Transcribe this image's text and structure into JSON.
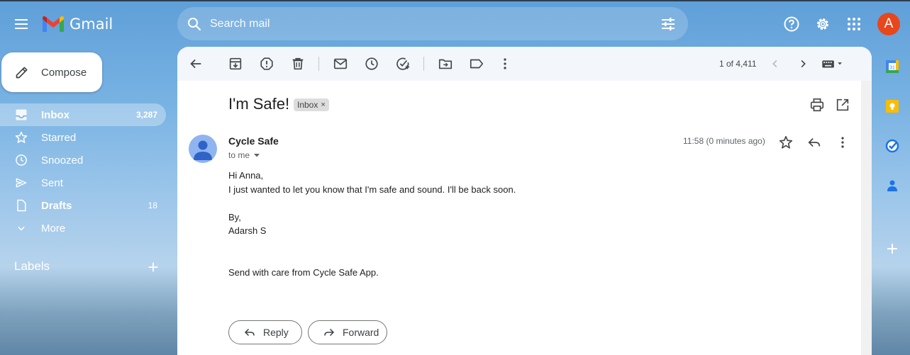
{
  "app": {
    "name": "Gmail"
  },
  "header": {
    "search_placeholder": "Search mail",
    "avatar_initial": "A"
  },
  "nav": {
    "compose_label": "Compose",
    "items": [
      {
        "label": "Inbox",
        "count": "3,287",
        "icon": "inbox-icon",
        "active": true
      },
      {
        "label": "Starred",
        "count": "",
        "icon": "star-icon"
      },
      {
        "label": "Snoozed",
        "count": "",
        "icon": "clock-icon"
      },
      {
        "label": "Sent",
        "count": "",
        "icon": "send-icon"
      },
      {
        "label": "Drafts",
        "count": "18",
        "icon": "draft-icon"
      },
      {
        "label": "More",
        "count": "",
        "icon": "chevron-down-icon"
      }
    ],
    "labels_title": "Labels"
  },
  "toolbar": {
    "page_count": "1 of 4,411"
  },
  "email": {
    "subject": "I'm Safe!",
    "label_chip": "Inbox",
    "label_chip_close": "×",
    "sender_name": "Cycle Safe",
    "recipient": "to me",
    "time": "11:58 (0 minutes ago)",
    "body": [
      "Hi Anna,",
      "I just wanted to let you know that I'm safe and sound. I'll be back soon.",
      "By,",
      "Adarsh S",
      "Send with care from Cycle Safe App."
    ],
    "reply_label": "Reply",
    "forward_label": "Forward"
  },
  "colors": {
    "avatar_bg": "#e8471c",
    "panel_bg": "#ffffff",
    "toolbar_bg": "#f3f6fb",
    "accent": "#1a73e8"
  }
}
